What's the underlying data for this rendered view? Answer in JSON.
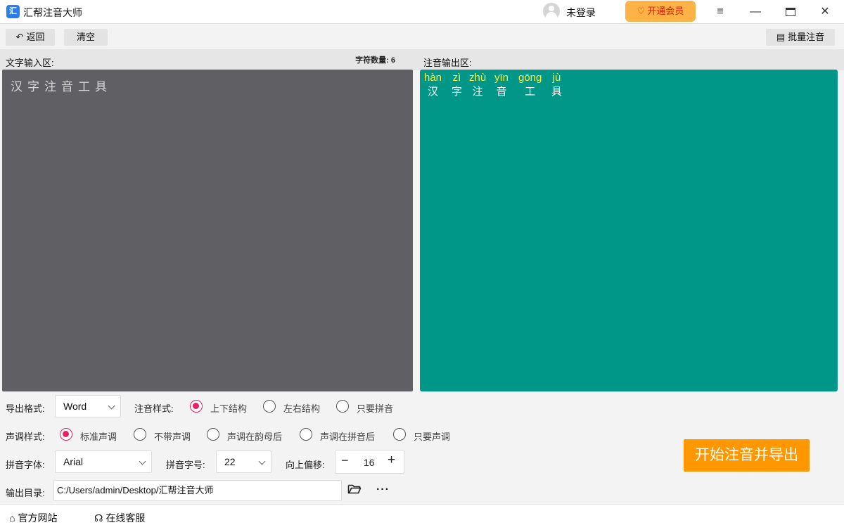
{
  "app": {
    "logo_text": "汇",
    "title": "汇帮注音大师",
    "login": "未登录",
    "vip": "开通会员"
  },
  "window": {
    "menu_glyph": "≡",
    "min_glyph": "—",
    "close_glyph": "✕"
  },
  "toolbar": {
    "back": "返回",
    "clear": "清空",
    "batch": "批量注音"
  },
  "input_panel": {
    "label": "文字输入区:",
    "count_label": "字符数量:",
    "count": "6",
    "text": "汉字注音工具"
  },
  "output_panel": {
    "label": "注音输出区:",
    "pinyin_color": "#ffee33",
    "chars": [
      {
        "py": "hàn",
        "hz": "汉"
      },
      {
        "py": "zì",
        "hz": "字"
      },
      {
        "py": "zhù",
        "hz": "注"
      },
      {
        "py": "yīn",
        "hz": "音"
      },
      {
        "py": "gōng",
        "hz": "工"
      },
      {
        "py": "jù",
        "hz": "具"
      }
    ]
  },
  "options": {
    "export_format": {
      "label": "导出格式:",
      "value": "Word"
    },
    "annotation_style": {
      "label": "注音样式:",
      "options": [
        "上下结构",
        "左右结构",
        "只要拼音"
      ],
      "selected": 0
    },
    "tone_style": {
      "label": "声调样式:",
      "options": [
        "标准声调",
        "不带声调",
        "声调在韵母后",
        "声调在拼音后",
        "只要声调"
      ],
      "selected": 0
    },
    "pinyin_font": {
      "label": "拼音字体:",
      "value": "Arial"
    },
    "pinyin_size": {
      "label": "拼音字号:",
      "value": "22"
    },
    "offset": {
      "label": "向上偏移:",
      "value": "16",
      "minus": "−",
      "plus": "+"
    },
    "output_dir": {
      "label": "输出目录:",
      "value": "C:/Users/admin/Desktop/汇帮注音大师",
      "more": "···"
    }
  },
  "start_button": "开始注音并导出",
  "accent_colors": {
    "input_bg": "#606064",
    "output_bg": "#009688",
    "start": "#ff9800",
    "radio": "#e91e63"
  },
  "footer": {
    "site": "官方网站",
    "service": "在线客服"
  }
}
